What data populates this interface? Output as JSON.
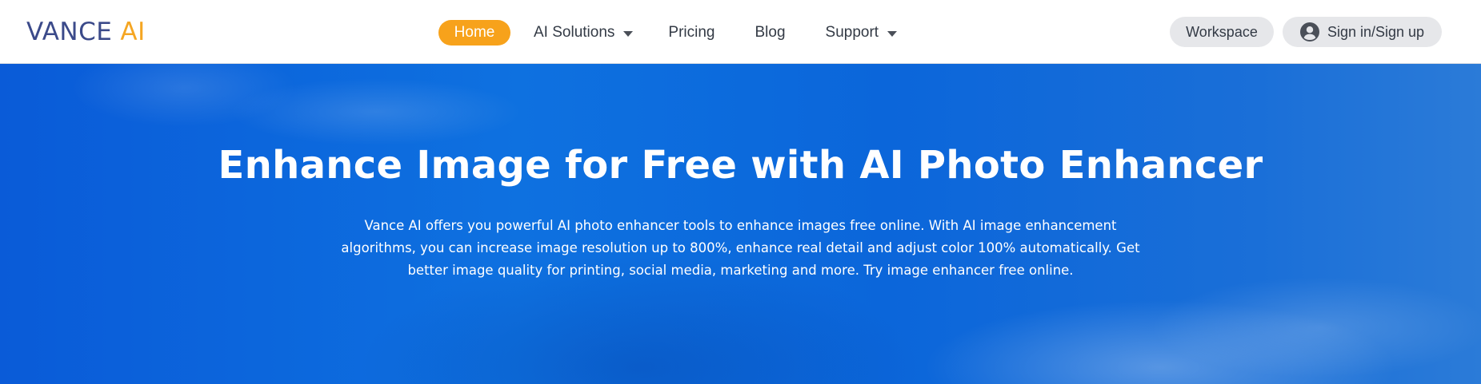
{
  "header": {
    "logo": {
      "part1": "VANCE",
      "part2": "AI"
    },
    "nav": {
      "home": "Home",
      "ai_solutions": "AI Solutions",
      "pricing": "Pricing",
      "blog": "Blog",
      "support": "Support"
    },
    "workspace_label": "Workspace",
    "signin_label": "Sign in/Sign up"
  },
  "hero": {
    "title": "Enhance Image for Free with AI Photo Enhancer",
    "description": "Vance AI offers you powerful AI photo enhancer tools to enhance images free online. With AI image enhancement algorithms, you can increase image resolution up to 800%, enhance real detail and adjust color 100% automatically. Get better image quality for printing, social media, marketing and more. Try image enhancer free online."
  },
  "colors": {
    "brand_blue": "#3b4a8a",
    "brand_orange": "#f7a21b",
    "hero_blue": "#0e71e0",
    "button_gray": "#e6e7ea"
  },
  "icons": {
    "dropdown": "chevron-down-icon",
    "user": "user-avatar-icon"
  }
}
